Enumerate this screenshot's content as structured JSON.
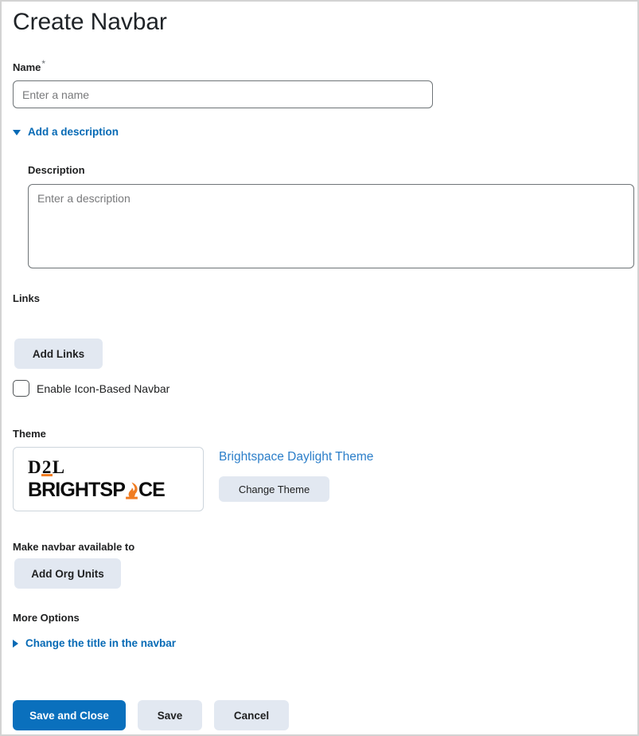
{
  "page": {
    "title": "Create Navbar"
  },
  "name_field": {
    "label": "Name",
    "required_mark": "*",
    "placeholder": "Enter a name",
    "value": ""
  },
  "description_disclosure": {
    "label": "Add a description",
    "state": "expanded",
    "icon": "triangle-down-icon"
  },
  "description_field": {
    "label": "Description",
    "placeholder": "Enter a description",
    "value": ""
  },
  "links_section": {
    "label": "Links",
    "add_links_button": "Add Links",
    "icon_navbar_checkbox": {
      "label": "Enable Icon-Based Navbar",
      "checked": false
    }
  },
  "theme_section": {
    "label": "Theme",
    "thumbnail": {
      "logo_top": "D2L",
      "logo_bottom": "BRIGHTSP",
      "logo_bottom_tail": "CE",
      "flame_icon": "flame-icon",
      "accent_color": "#f07c22"
    },
    "theme_name": "Brightspace Daylight Theme",
    "change_theme_button": "Change Theme"
  },
  "availability_section": {
    "label": "Make navbar available to",
    "add_org_units_button": "Add Org Units"
  },
  "more_options_section": {
    "label": "More Options",
    "change_title_disclosure": {
      "label": "Change the title in the navbar",
      "state": "collapsed",
      "icon": "triangle-right-icon"
    }
  },
  "footer": {
    "save_and_close_label": "Save and Close",
    "save_label": "Save",
    "cancel_label": "Cancel"
  },
  "colors": {
    "primary_button": "#0a70bd",
    "secondary_button": "#e2e8f1",
    "link": "#066ab5",
    "theme_link": "#2b7ec9",
    "brand_accent": "#f07c22",
    "page_border": "#d3d3d3"
  }
}
